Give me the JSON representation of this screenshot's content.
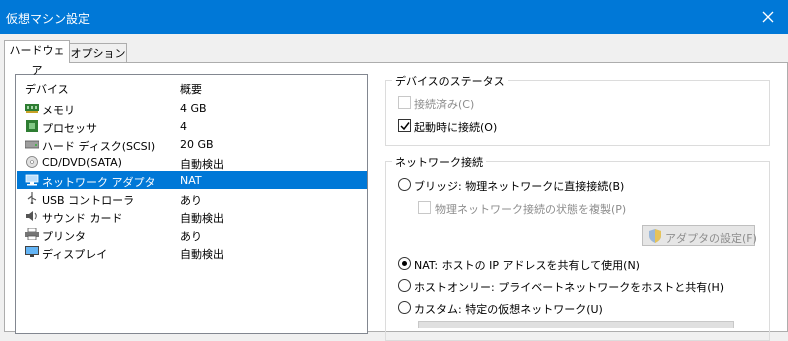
{
  "window": {
    "title": "仮想マシン設定"
  },
  "tabs": [
    {
      "label": "ハードウェア"
    },
    {
      "label": "オプション"
    }
  ],
  "device_list": {
    "headers": [
      "デバイス",
      "概要"
    ],
    "rows": [
      {
        "name": "メモリ",
        "summary": "4 GB",
        "icon": "memory-icon"
      },
      {
        "name": "プロセッサ",
        "summary": "4",
        "icon": "processor-icon"
      },
      {
        "name": "ハード ディスク(SCSI)",
        "summary": "20 GB",
        "icon": "hard-disk-icon"
      },
      {
        "name": "CD/DVD(SATA)",
        "summary": "自動検出",
        "icon": "cd-dvd-icon"
      },
      {
        "name": "ネットワーク アダプタ",
        "summary": "NAT",
        "icon": "network-adapter-icon",
        "selected": true
      },
      {
        "name": "USB コントローラ",
        "summary": "あり",
        "icon": "usb-icon"
      },
      {
        "name": "サウンド カード",
        "summary": "自動検出",
        "icon": "speaker-icon"
      },
      {
        "name": "プリンタ",
        "summary": "あり",
        "icon": "printer-icon"
      },
      {
        "name": "ディスプレイ",
        "summary": "自動検出",
        "icon": "display-icon"
      }
    ]
  },
  "device_status": {
    "title": "デバイスのステータス",
    "connected": {
      "label": "接続済み(C)",
      "checked": false,
      "disabled": true
    },
    "connect_at_power_on": {
      "label": "起動時に接続(O)",
      "checked": true
    }
  },
  "network": {
    "title": "ネットワーク接続",
    "bridged": {
      "label": "ブリッジ: 物理ネットワークに直接接続(B)",
      "selected": false
    },
    "replicate": {
      "label": "物理ネットワーク接続の状態を複製(P)",
      "checked": false,
      "disabled": true
    },
    "adapter_settings_button": "アダプタの設定(F)",
    "nat": {
      "label": "NAT: ホストの IP アドレスを共有して使用(N)",
      "selected": true
    },
    "host_only": {
      "label": "ホストオンリー: プライベートネットワークをホストと共有(H)",
      "selected": false
    },
    "custom": {
      "label": "カスタム: 特定の仮想ネットワーク(U)",
      "selected": false
    }
  },
  "colors": {
    "titlebar": "#0078d7",
    "selection": "#0078d7"
  }
}
